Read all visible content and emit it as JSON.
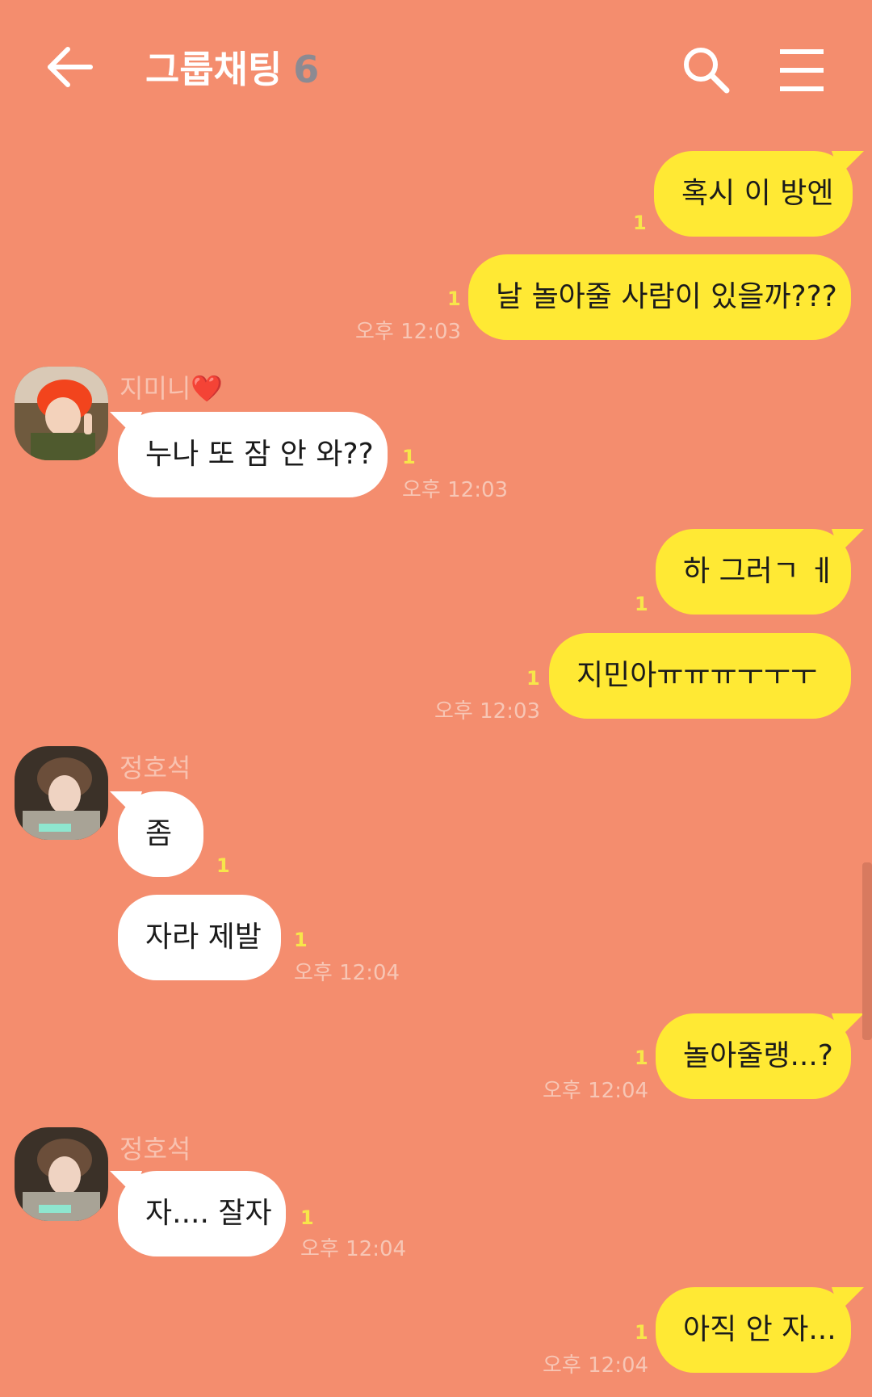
{
  "header": {
    "title": "그룹채팅",
    "member_count": "6"
  },
  "messages": [
    {
      "text": "혹시 이 방엔",
      "unread": "1"
    },
    {
      "text": "날 놀아줄 사람이 있을까???",
      "unread": "1",
      "time": "오후 12:03"
    },
    {
      "sender": "지미니❤️",
      "text": "누나 또 잠 안 와??",
      "unread": "1",
      "time": "오후 12:03"
    },
    {
      "text": "하 그러ㄱ ㅔ",
      "unread": "1"
    },
    {
      "text": "지민아ㅠㅠㅠㅜㅜㅜ",
      "unread": "1",
      "time": "오후 12:03"
    },
    {
      "sender": "정호석",
      "text": "좀",
      "unread": "1"
    },
    {
      "text": "자라 제발",
      "unread": "1",
      "time": "오후 12:04"
    },
    {
      "text": "놀아줄랭...?",
      "unread": "1",
      "time": "오후 12:04"
    },
    {
      "sender": "정호석",
      "text": "자.... 잘자",
      "unread": "1",
      "time": "오후 12:04"
    },
    {
      "text": "아직 안 자...",
      "unread": "1",
      "time": "오후 12:04"
    }
  ],
  "colors": {
    "background": "#f48d6e",
    "my_bubble": "#ffe934",
    "their_bubble": "#ffffff",
    "unread": "#f7e64a"
  }
}
